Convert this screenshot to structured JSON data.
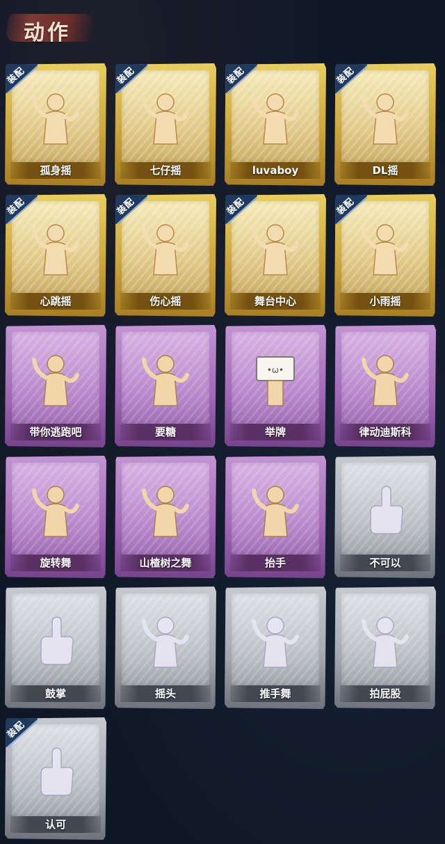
{
  "header": {
    "title": "动作"
  },
  "badge_label": "装配",
  "colors": {
    "gold": "#cda63a",
    "purple": "#9f66b5",
    "silver": "#a1a6ad",
    "badge": "#1f3a5e",
    "background": "#0f1826"
  },
  "emotes": [
    {
      "label": "孤身摇",
      "rarity": "gold",
      "equipped": true,
      "icon": "dancer-swaying-icon"
    },
    {
      "label": "七仔摇",
      "rarity": "gold",
      "equipped": true,
      "icon": "dancer-arms-crossed-icon"
    },
    {
      "label": "luvaboy",
      "rarity": "gold",
      "equipped": true,
      "icon": "dancer-twist-icon"
    },
    {
      "label": "DL摇",
      "rarity": "gold",
      "equipped": true,
      "icon": "dancer-arm-raised-icon"
    },
    {
      "label": "心跳摇",
      "rarity": "gold",
      "equipped": true,
      "icon": "dancer-hand-up-icon"
    },
    {
      "label": "伤心摇",
      "rarity": "gold",
      "equipped": true,
      "icon": "dancer-heart-hands-icon"
    },
    {
      "label": "舞台中心",
      "rarity": "gold",
      "equipped": true,
      "icon": "dancer-pose-icon"
    },
    {
      "label": "小雨摇",
      "rarity": "gold",
      "equipped": true,
      "icon": "dancer-lean-icon"
    },
    {
      "label": "带你逃跑吧",
      "rarity": "purple",
      "equipped": false,
      "icon": "dancer-point-icon"
    },
    {
      "label": "要糖",
      "rarity": "purple",
      "equipped": false,
      "icon": "figure-reach-icon"
    },
    {
      "label": "举牌",
      "rarity": "purple",
      "equipped": false,
      "icon": "figure-sign-icon"
    },
    {
      "label": "律动迪斯科",
      "rarity": "purple",
      "equipped": false,
      "icon": "dancer-disco-icon"
    },
    {
      "label": "旋转舞",
      "rarity": "purple",
      "equipped": false,
      "icon": "dancer-spin-icon"
    },
    {
      "label": "山楂树之舞",
      "rarity": "purple",
      "equipped": false,
      "icon": "dancer-wave-icon"
    },
    {
      "label": "抬手",
      "rarity": "purple",
      "equipped": false,
      "icon": "figure-raise-hand-icon"
    },
    {
      "label": "不可以",
      "rarity": "silver",
      "equipped": false,
      "icon": "finger-wag-icon"
    },
    {
      "label": "鼓掌",
      "rarity": "silver",
      "equipped": false,
      "icon": "clapping-hands-icon"
    },
    {
      "label": "摇头",
      "rarity": "silver",
      "equipped": false,
      "icon": "figure-shake-head-icon"
    },
    {
      "label": "推手舞",
      "rarity": "silver",
      "equipped": false,
      "icon": "figure-push-hands-icon"
    },
    {
      "label": "拍屁股",
      "rarity": "silver",
      "equipped": false,
      "icon": "figure-slap-icon"
    },
    {
      "label": "认可",
      "rarity": "silver",
      "equipped": true,
      "icon": "thumbs-up-icon"
    }
  ]
}
